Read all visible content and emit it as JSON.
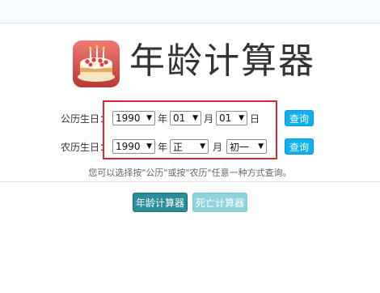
{
  "title": "年龄计算器",
  "solar_row": {
    "label": "公历生日：",
    "year": "1990",
    "year_unit": "年",
    "month": "01",
    "month_unit": "月",
    "day": "01",
    "day_unit": "日",
    "query_label": "查询"
  },
  "lunar_row": {
    "label": "农历生日：",
    "year": "1990",
    "year_unit": "年",
    "month": "正",
    "month_unit": "月",
    "day": "初一",
    "query_label": "查询"
  },
  "hint": "您可以选择按\"公历\"或按\"农历\"任意一种方式查询。",
  "buttons": {
    "age_calc": "年龄计算器",
    "death_calc": "死亡计算器"
  },
  "colors": {
    "accent_blue": "#0fb0ee",
    "teal_button": "#2a8d99",
    "light_teal_button": "#8fd3dc",
    "highlight_red": "#d8292f"
  },
  "icons": {
    "logo": "birthday-cake-icon",
    "dropdown": "triangle-down"
  }
}
